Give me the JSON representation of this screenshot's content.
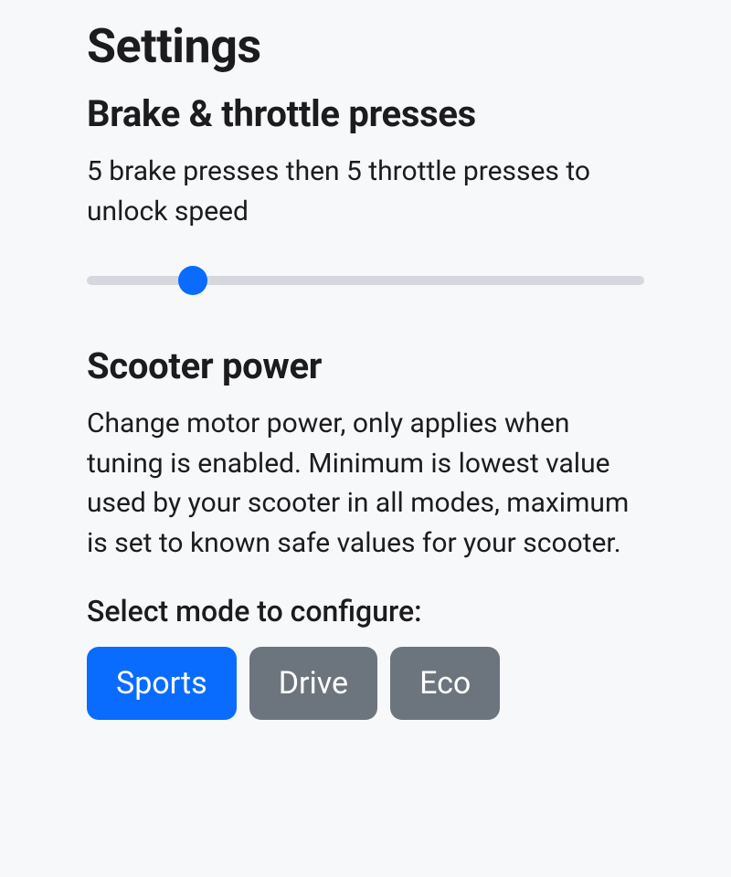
{
  "page": {
    "title": "Settings"
  },
  "brake_throttle": {
    "title": "Brake & throttle presses",
    "description": "5 brake presses then 5 throttle presses to unlock speed",
    "slider_percent": 19
  },
  "scooter_power": {
    "title": "Scooter power",
    "description": "Change motor power, only applies when tuning is enabled. Minimum is lowest value used by your scooter in all modes, maximum is set to known safe values for your scooter.",
    "mode_label": "Select mode to configure:",
    "modes": [
      {
        "label": "Sports",
        "active": true
      },
      {
        "label": "Drive",
        "active": false
      },
      {
        "label": "Eco",
        "active": false
      }
    ]
  }
}
